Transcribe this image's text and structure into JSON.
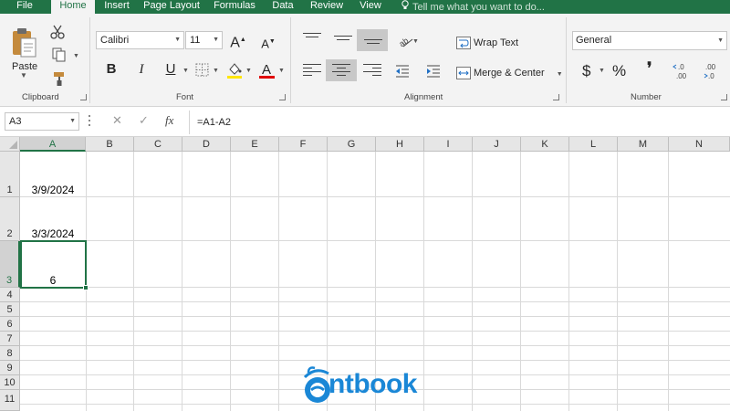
{
  "tabs": [
    {
      "label": "File",
      "active": false
    },
    {
      "label": "Home",
      "active": true
    },
    {
      "label": "Insert",
      "active": false
    },
    {
      "label": "Page Layout",
      "active": false
    },
    {
      "label": "Formulas",
      "active": false
    },
    {
      "label": "Data",
      "active": false
    },
    {
      "label": "Review",
      "active": false
    },
    {
      "label": "View",
      "active": false
    }
  ],
  "tell_me_placeholder": "Tell me what you want to do...",
  "ribbon": {
    "clipboard": {
      "paste_label": "Paste",
      "group_label": "Clipboard"
    },
    "font": {
      "font_name": "Calibri",
      "font_size": "11",
      "bold": "B",
      "italic": "I",
      "underline": "U",
      "group_label": "Font"
    },
    "alignment": {
      "wrap_text_label": "Wrap Text",
      "merge_center_label": "Merge & Center",
      "group_label": "Alignment"
    },
    "number": {
      "format": "General",
      "currency": "$",
      "percent": "%",
      "comma": "❜",
      "increase_decimal": "←.0\n.00",
      "decrease_decimal": ".00\n→.0",
      "group_label": "Number"
    }
  },
  "formula_bar": {
    "name_box": "A3",
    "cancel_symbol": "✕",
    "enter_symbol": "✓",
    "fx_label": "fx",
    "formula": "=A1-A2"
  },
  "sheet": {
    "columns": [
      "A",
      "B",
      "C",
      "D",
      "E",
      "F",
      "G",
      "H",
      "I",
      "J",
      "K",
      "L",
      "M",
      "N"
    ],
    "rows": [
      "1",
      "2",
      "3",
      "4",
      "5",
      "6",
      "7",
      "8",
      "9",
      "10",
      "11"
    ],
    "selected_cell": "A3",
    "cells": {
      "A1": "3/9/2024",
      "A2": "3/3/2024",
      "A3": "6"
    }
  },
  "watermark": {
    "text": "ntbook",
    "color": "#1a87d6"
  },
  "colors": {
    "accent": "#217346",
    "font_color_bar": "#e00000",
    "fill_color_bar": "#ffe600"
  }
}
